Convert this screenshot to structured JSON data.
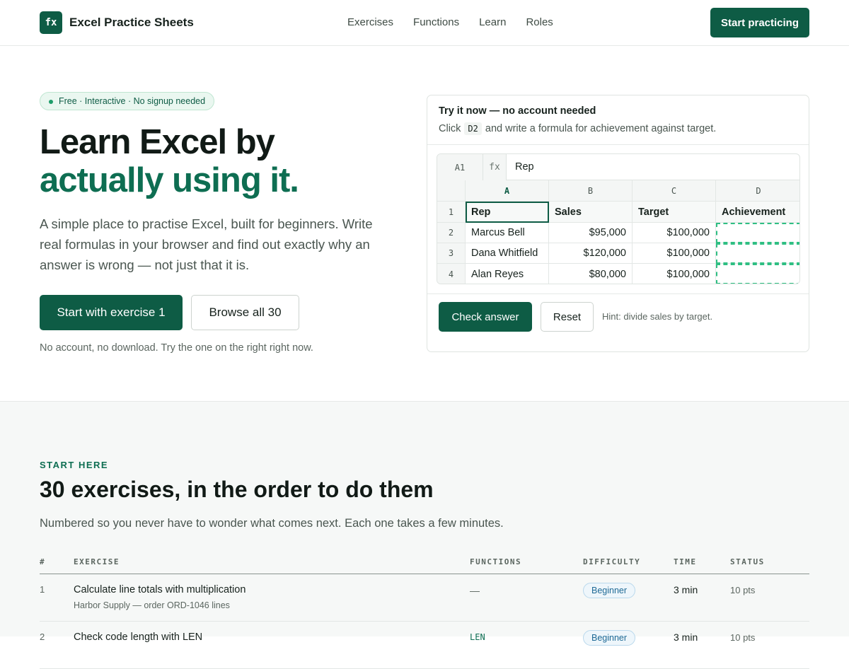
{
  "nav": {
    "logo_mark": "fx",
    "brand": "Excel Practice Sheets",
    "links": [
      "Exercises",
      "Functions",
      "Learn",
      "Roles"
    ],
    "cta": "Start practicing"
  },
  "hero": {
    "pill": "Free · Interactive · No signup needed",
    "title_line1": "Learn Excel by",
    "title_line2": "actually using it.",
    "subtitle": "A simple place to practise Excel, built for beginners. Write real formulas in your browser and find out exactly why an answer is wrong — not just that it is.",
    "primary_button": "Start with exercise 1",
    "secondary_button": "Browse all 30",
    "note": "No account, no download. Try the one on the right right now."
  },
  "practice": {
    "title": "Try it now — no account needed",
    "desc_before": "Click",
    "desc_cell": "D2",
    "desc_after": "and write a formula for achievement against target.",
    "formula_bar": {
      "cell_ref": "A1",
      "fx": "fx",
      "value": "Rep"
    },
    "columns": [
      "A",
      "B",
      "C",
      "D"
    ],
    "row_numbers": [
      "1",
      "2",
      "3",
      "4"
    ],
    "rows": [
      [
        "Rep",
        "Sales",
        "Target",
        "Achievement"
      ],
      [
        "Marcus Bell",
        "$95,000",
        "$100,000",
        ""
      ],
      [
        "Dana Whitfield",
        "$120,000",
        "$100,000",
        ""
      ],
      [
        "Alan Reyes",
        "$80,000",
        "$100,000",
        ""
      ]
    ],
    "check_button": "Check answer",
    "reset_button": "Reset",
    "hint": "Hint: divide sales by target."
  },
  "exercises": {
    "eyebrow": "START HERE",
    "title": "30 exercises, in the order to do them",
    "subtitle": "Numbered so you never have to wonder what comes next. Each one takes a few minutes.",
    "headers": [
      "#",
      "EXERCISE",
      "FUNCTIONS",
      "DIFFICULTY",
      "TIME",
      "STATUS"
    ],
    "rows": [
      {
        "num": "1",
        "title": "Calculate line totals with multiplication",
        "subtitle": "Harbor Supply — order ORD-1046 lines",
        "functions": "—",
        "difficulty": "Beginner",
        "time": "3 min",
        "status": "10 pts"
      },
      {
        "num": "2",
        "title": "Check code length with LEN",
        "subtitle": "",
        "functions": "LEN",
        "difficulty": "Beginner",
        "time": "3 min",
        "status": "10 pts"
      }
    ]
  },
  "colors": {
    "brand_green": "#0e5c45",
    "accent_green": "#0e6e52",
    "target_dashed": "#2fbf83",
    "badge_blue": "#1f6a96"
  }
}
